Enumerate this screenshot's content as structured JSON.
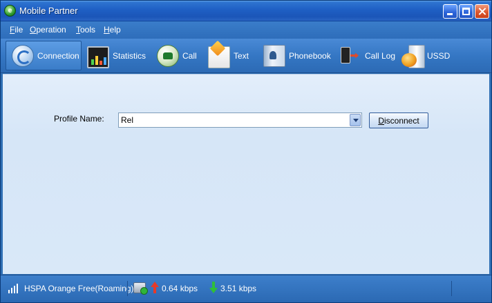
{
  "window": {
    "title": "Mobile Partner",
    "app_icon_letter": "e"
  },
  "menu": [
    {
      "key": "F",
      "rest": "ile"
    },
    {
      "key": "O",
      "rest": "peration"
    },
    {
      "key": "T",
      "rest": "ools"
    },
    {
      "key": "H",
      "rest": "elp"
    }
  ],
  "toolbar": {
    "connection": "Connection",
    "statistics": "Statistics",
    "call": "Call",
    "text": "Text",
    "phonebook": "Phonebook",
    "call_log": "Call Log",
    "ussd": "USSD",
    "active": "connection"
  },
  "profile": {
    "label": "Profile Name:",
    "value": "Rel"
  },
  "disconnect": {
    "key": "D",
    "rest": "isconnect"
  },
  "status": {
    "network": "HSPA  Orange Free(Roaming)",
    "upload": "0.64 kbps",
    "download": "3.51 kbps"
  },
  "colors": {
    "title_bar": "#1f5fc4",
    "toolbar": "#3577c4",
    "content_bg": "#d9e8f8",
    "upload_arrow": "#e53a2a",
    "download_arrow": "#2fbf37"
  }
}
